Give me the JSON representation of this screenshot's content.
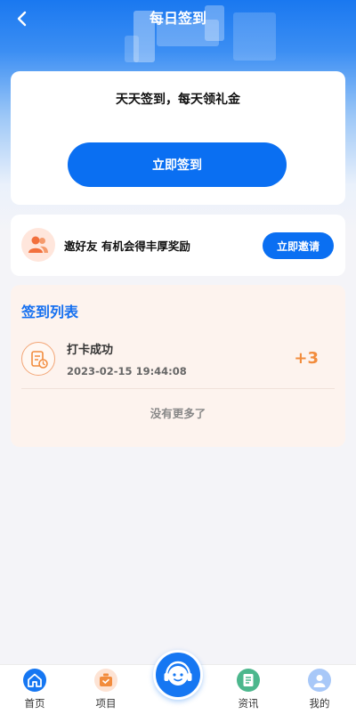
{
  "header": {
    "title": "每日签到",
    "back_icon": "chevron-left-icon"
  },
  "signin_card": {
    "slogan": "天天签到，每天领礼金",
    "button_label": "立即签到"
  },
  "invite_card": {
    "icon": "people-icon",
    "text": "邀好友 有机会得丰厚奖励",
    "button_label": "立即邀请"
  },
  "signin_list": {
    "title": "签到列表",
    "records": [
      {
        "icon": "document-clock-icon",
        "title": "打卡成功",
        "time": "2023-02-15 19:44:08",
        "points": "+3"
      }
    ],
    "end_text": "没有更多了"
  },
  "tabbar": {
    "items": [
      {
        "label": "首页",
        "icon": "home-icon",
        "color": "#1677f2"
      },
      {
        "label": "项目",
        "icon": "bag-icon",
        "color": "#f28c3d"
      },
      {
        "label": "资讯",
        "icon": "news-icon",
        "color": "#4cb78d"
      },
      {
        "label": "我的",
        "icon": "user-icon",
        "color": "#8fb7f5"
      }
    ],
    "center_icon": "customer-service-icon"
  },
  "colors": {
    "primary": "#0a6ff2",
    "accent_orange": "#f28c3d",
    "list_bg": "#fdf3ee"
  }
}
